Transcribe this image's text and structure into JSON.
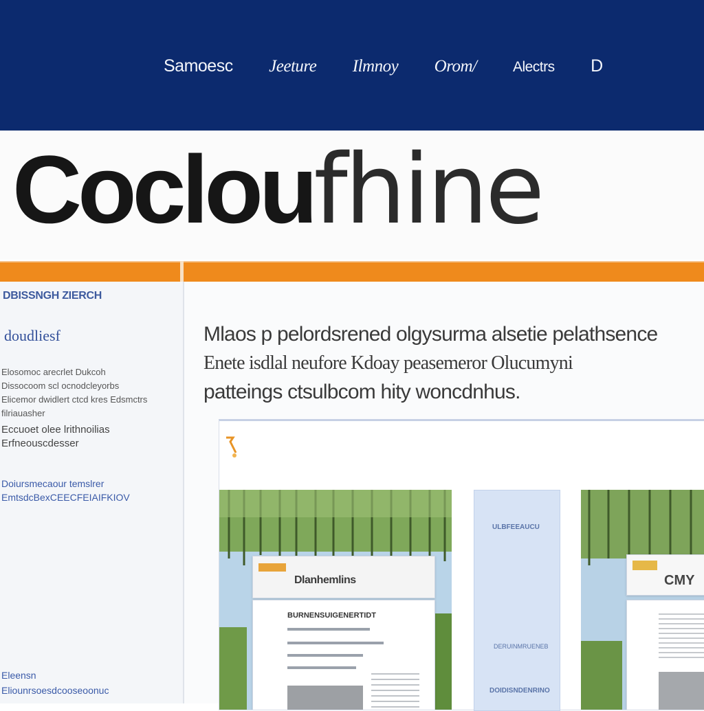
{
  "nav": {
    "items": [
      "Samoesc",
      "Jeeture",
      "Ilmnoy",
      "Orom/",
      "Alectrs",
      "D"
    ]
  },
  "logo": {
    "part1": "Coclou",
    "part2": "fhine"
  },
  "sidebar": {
    "heading": "DBISSNGH ZIERCH",
    "link": "doudliesf",
    "para1": "Elosomoc arecrlet Dukcoh Dissocoom scl ocnodcleyorbs Elicemor dwidlert ctcd kres Edsmctrs filriauasher",
    "para2": "Eccuoet olee lrithnoilias Erfneouscdesser",
    "link2": "Doiursmecaour temslrer EmtsdcBexCEECFEIAIFKIOV",
    "footer": [
      "Eleensn",
      "Eliounrsoesdcooseoonuc"
    ]
  },
  "main": {
    "intro_line1": "Mlaos p pelordsrened olgysurma alsetie pelathsence",
    "intro_line2": "Enete isdlal neufore Kdoay peasemeror Olucumyni",
    "intro_line3": "patteings ctsulbcom hity woncdnhus.",
    "gallery": {
      "card1_title": "Dlanhemlins",
      "card2_heading": "BURNENSUIGENERTIDT",
      "side_label1": "ULBFEEAUCU",
      "side_label2": "DERUINMRUENEB",
      "side_label3": "DOIDISNDENRINO",
      "card3_title": "CMY"
    }
  },
  "colors": {
    "nav_background": "#0c2a6e",
    "accent_orange": "#ef8a1c",
    "link_blue": "#33509a"
  }
}
